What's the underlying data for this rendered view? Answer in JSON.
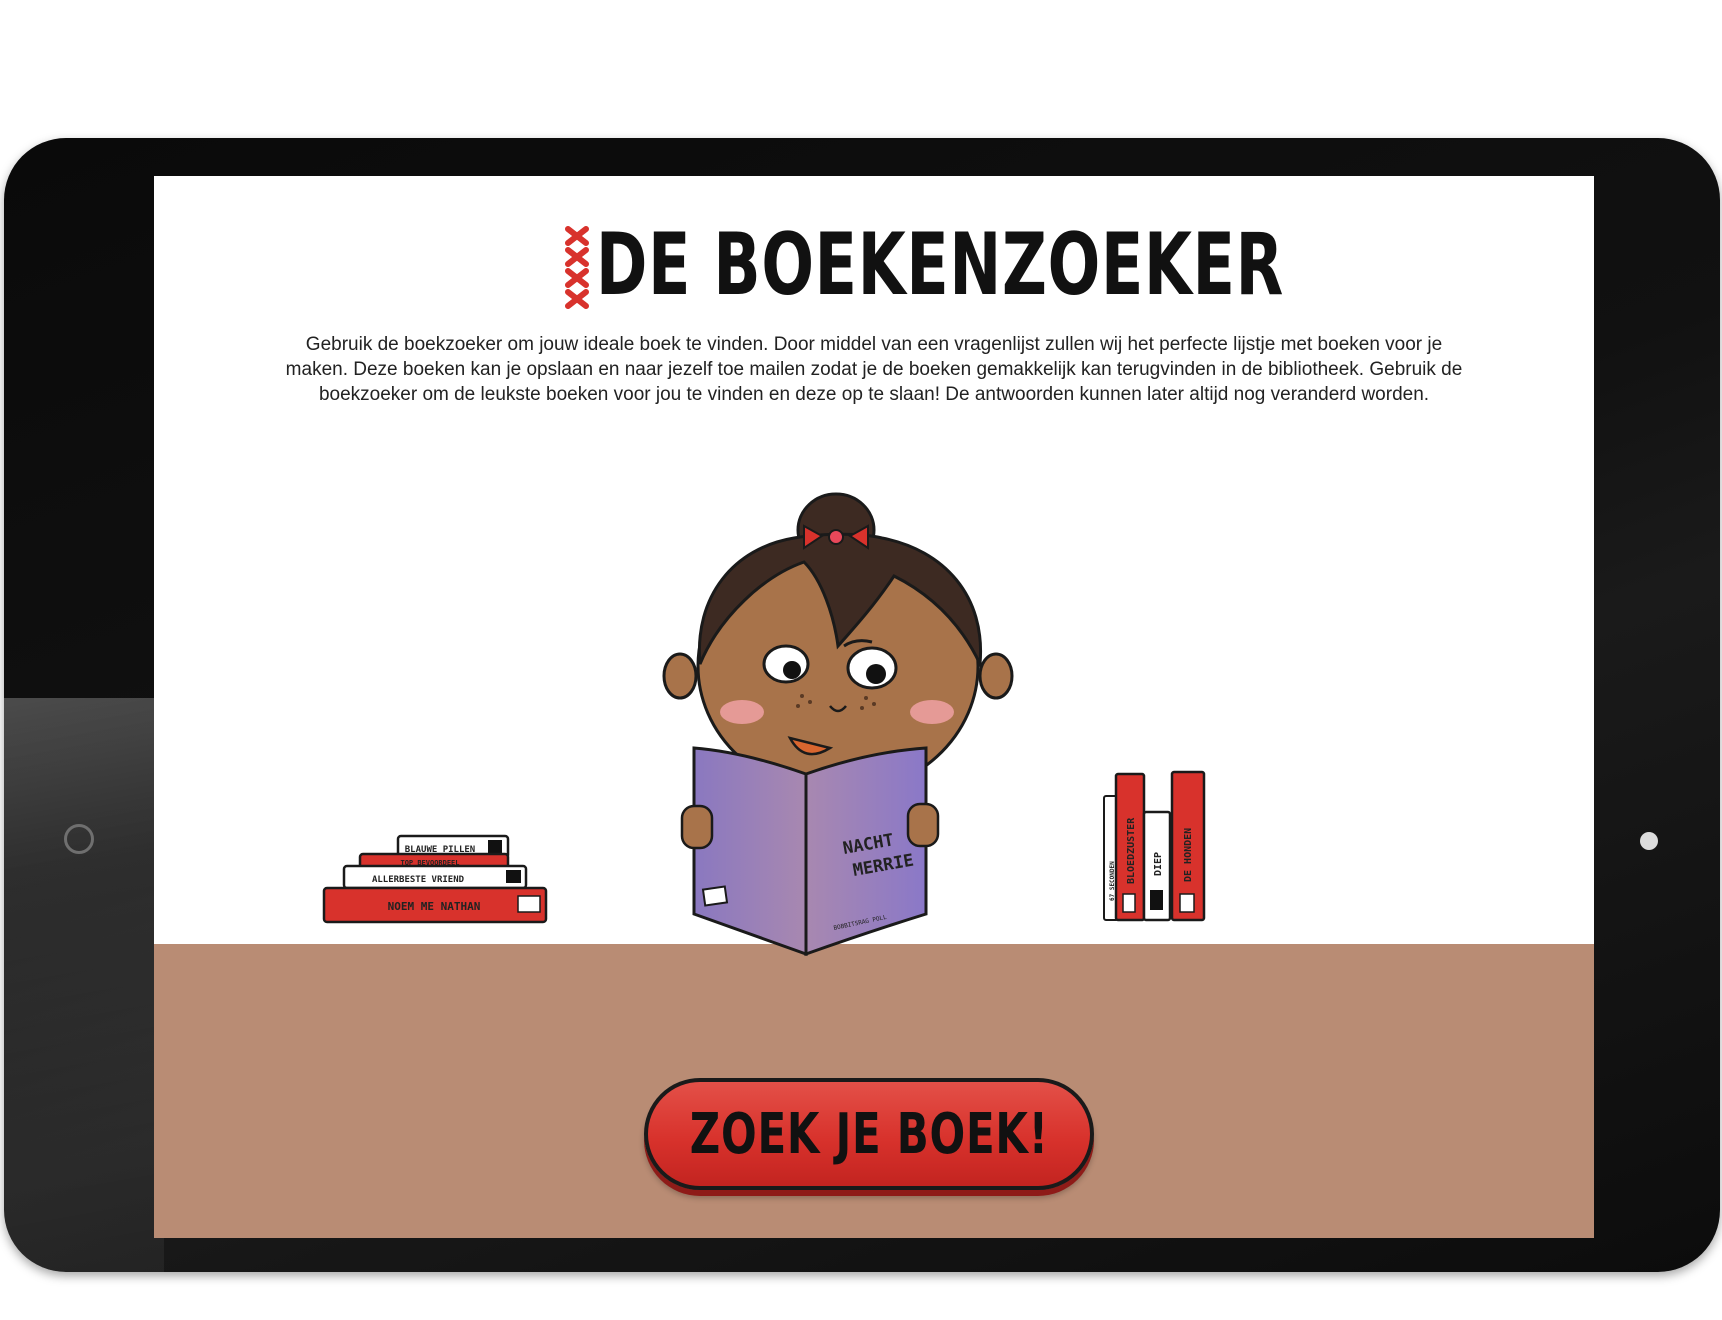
{
  "logo": {
    "title": "DE BOEKENZOEKER"
  },
  "intro": {
    "text": "Gebruik de boekzoeker om jouw ideale boek te vinden. Door middel van een vragenlijst zullen wij het perfecte lijstje met boeken voor je maken. Deze boeken kan je opslaan en naar jezelf toe mailen zodat je de boeken gemakkelijk kan terugvinden in de bibliotheek. Gebruik de boekzoeker om de leukste boeken voor jou te vinden en deze op te slaan! De antwoorden kunnen later altijd nog veranderd worden."
  },
  "reading_book": {
    "title": "NACHT MERRIE",
    "title_line1": "NACHT",
    "title_line2": "MERRIE",
    "author": "BOBBITSRAG POLL"
  },
  "left_stack": [
    {
      "title": "BLAUWE PILLEN"
    },
    {
      "title": "TOP BEVOORDEEL"
    },
    {
      "title": "ALLERBESTE VRIEND"
    },
    {
      "title": "NOEM ME NATHAN"
    }
  ],
  "right_shelf": [
    {
      "title": "67 SECONDEN"
    },
    {
      "title": "BLOEDZUSTER"
    },
    {
      "title": "DIEP"
    },
    {
      "title": "DE HONDEN"
    }
  ],
  "cta": {
    "label": "ZOEK JE BOEK!"
  },
  "colors": {
    "accent_red": "#d8322c",
    "floor": "#b98c74",
    "book_purple": "#9b86c4",
    "skin": "#a8734a",
    "hair": "#3d2a22"
  },
  "icons": {
    "logo_mark": "amsterdam-crosses-icon"
  }
}
